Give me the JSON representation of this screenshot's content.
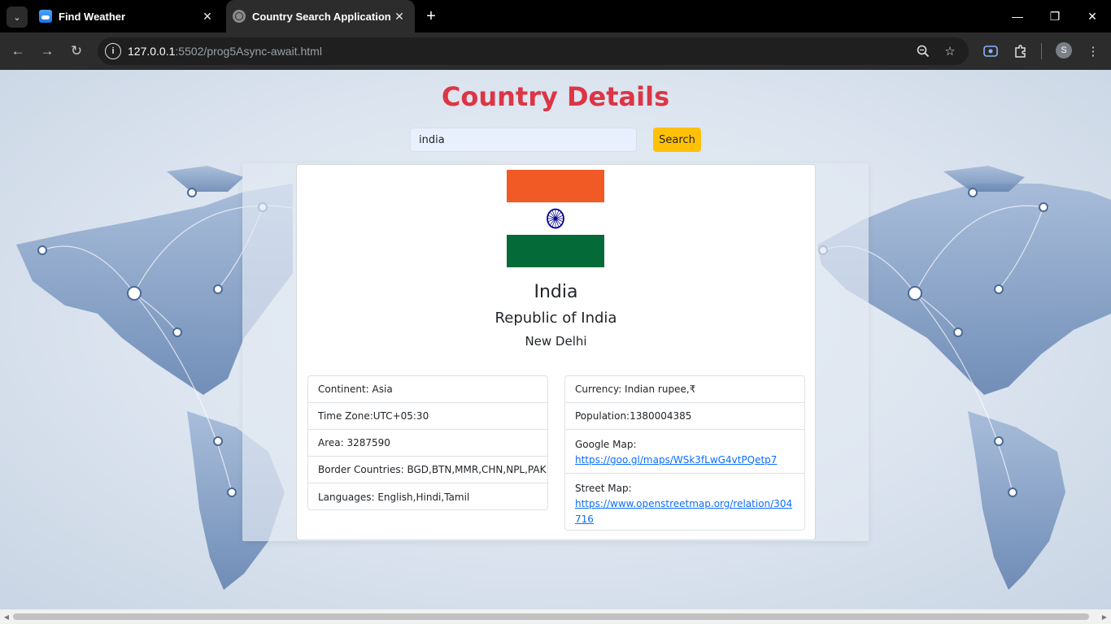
{
  "browser": {
    "tabs": [
      {
        "title": "Find Weather",
        "favicon": "weather-icon",
        "active": false
      },
      {
        "title": "Country Search Application",
        "favicon": "globe-icon",
        "active": true
      }
    ],
    "url_host": "127.0.0.1",
    "url_path": ":5502/prog5Async-await.html",
    "profile_initial": "S"
  },
  "page": {
    "title": "Country Details",
    "search": {
      "value": "india",
      "button_label": "Search"
    },
    "country": {
      "name": "India",
      "official_name": "Republic of India",
      "capital": "New Delhi",
      "flag_colors": [
        "#f15a25",
        "#ffffff",
        "#046a38"
      ],
      "left_details": [
        "Continent: Asia",
        "Time Zone:UTC+05:30",
        "Area: 3287590",
        "Border Countries: BGD,BTN,MMR,CHN,NPL,PAK",
        "Languages: English,Hindi,Tamil"
      ],
      "currency": "Currency: Indian rupee,₹",
      "population": "Population:1380004385",
      "google_map_label": "Google Map:",
      "google_map_url": "https://goo.gl/maps/WSk3fLwG4vtPQetp7",
      "street_map_label": "Street Map:",
      "street_map_url": "https://www.openstreetmap.org/relation/304716"
    }
  },
  "colors": {
    "title": "#dc3545",
    "search_button": "#ffc107",
    "link": "#0d6efd"
  }
}
